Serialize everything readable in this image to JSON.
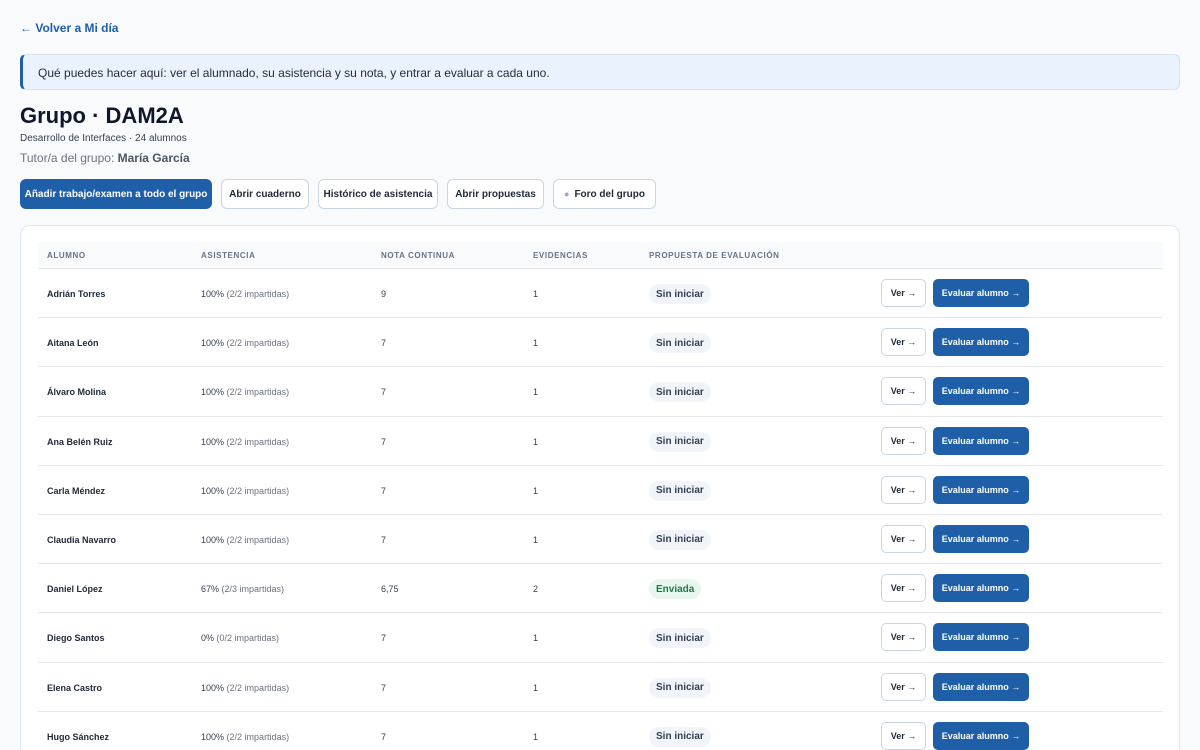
{
  "back_link": "← Volver a Mi día",
  "info_text": "Qué puedes hacer aquí: ver el alumnado, su asistencia y su nota, y entrar a evaluar a cada uno.",
  "title": "Grupo · DAM2A",
  "subtitle": "Desarrollo de Interfaces · 24 alumnos",
  "tutor": {
    "label": "Tutor/a del grupo:",
    "name": "María García"
  },
  "actions": {
    "add_work": "Añadir trabajo/examen a todo el grupo",
    "open_notebook": "Abrir cuaderno",
    "attendance_history": "Histórico de asistencia",
    "open_proposals": "Abrir propuestas",
    "group_forum": "Foro del grupo",
    "forum_icon": "speech-bubble-icon"
  },
  "table": {
    "headers": {
      "student": "Alumno",
      "attendance": "Asistencia",
      "grade": "Nota continua",
      "evidence": "Evidencias",
      "proposal": "Propuesta de evaluación"
    },
    "view_label": "Ver →",
    "evaluate_label": "Evaluar alumno →",
    "rows": [
      {
        "name": "Adrián Torres",
        "pct": "100%",
        "detail": "(2/2 impartidas)",
        "grade": "9",
        "evidence": "1",
        "status": "Sin iniciar",
        "status_kind": "neutral"
      },
      {
        "name": "Aitana León",
        "pct": "100%",
        "detail": "(2/2 impartidas)",
        "grade": "7",
        "evidence": "1",
        "status": "Sin iniciar",
        "status_kind": "neutral"
      },
      {
        "name": "Álvaro Molina",
        "pct": "100%",
        "detail": "(2/2 impartidas)",
        "grade": "7",
        "evidence": "1",
        "status": "Sin iniciar",
        "status_kind": "neutral"
      },
      {
        "name": "Ana Belén Ruiz",
        "pct": "100%",
        "detail": "(2/2 impartidas)",
        "grade": "7",
        "evidence": "1",
        "status": "Sin iniciar",
        "status_kind": "neutral"
      },
      {
        "name": "Carla Méndez",
        "pct": "100%",
        "detail": "(2/2 impartidas)",
        "grade": "7",
        "evidence": "1",
        "status": "Sin iniciar",
        "status_kind": "neutral"
      },
      {
        "name": "Claudia Navarro",
        "pct": "100%",
        "detail": "(2/2 impartidas)",
        "grade": "7",
        "evidence": "1",
        "status": "Sin iniciar",
        "status_kind": "neutral"
      },
      {
        "name": "Daniel López",
        "pct": "67%",
        "detail": "(2/3 impartidas)",
        "grade": "6,75",
        "evidence": "2",
        "status": "Enviada",
        "status_kind": "sent"
      },
      {
        "name": "Diego Santos",
        "pct": "0%",
        "detail": "(0/2 impartidas)",
        "grade": "7",
        "evidence": "1",
        "status": "Sin iniciar",
        "status_kind": "neutral"
      },
      {
        "name": "Elena Castro",
        "pct": "100%",
        "detail": "(2/2 impartidas)",
        "grade": "7",
        "evidence": "1",
        "status": "Sin iniciar",
        "status_kind": "neutral"
      },
      {
        "name": "Hugo Sánchez",
        "pct": "100%",
        "detail": "(2/2 impartidas)",
        "grade": "7",
        "evidence": "1",
        "status": "Sin iniciar",
        "status_kind": "neutral"
      }
    ]
  }
}
